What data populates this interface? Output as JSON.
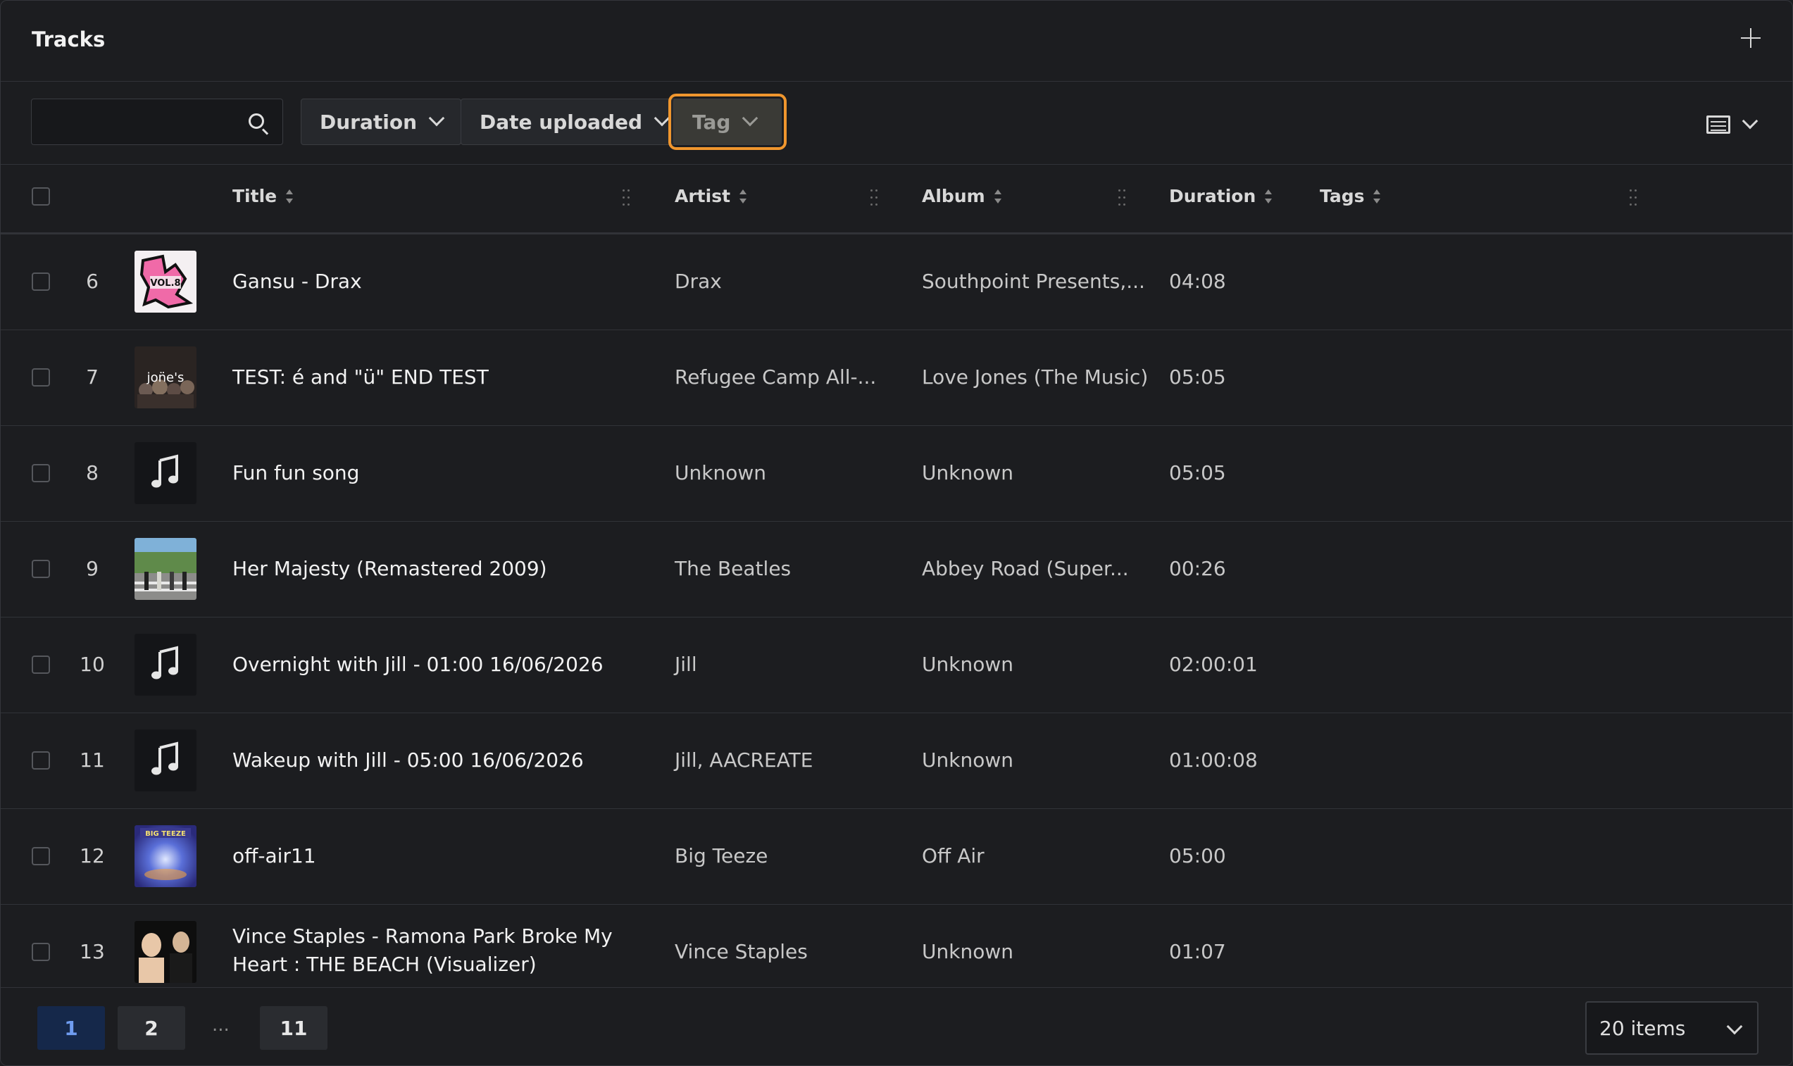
{
  "header": {
    "title": "Tracks",
    "add_icon": "plus-icon"
  },
  "toolbar": {
    "search": {
      "value": "",
      "placeholder": "",
      "icon": "search-icon"
    },
    "filters": {
      "duration": "Duration",
      "date_uploaded": "Date uploaded",
      "tag": "Tag"
    },
    "view_icon": "table-view-icon"
  },
  "table": {
    "columns": {
      "title": "Title",
      "artist": "Artist",
      "album": "Album",
      "duration": "Duration",
      "tags": "Tags"
    },
    "rows": [
      {
        "num": "6",
        "title": "Gansu - Drax",
        "artist": "Drax",
        "album": "Southpoint Presents,...",
        "duration": "04:08",
        "art": "vol8",
        "art_text": "VOL.8"
      },
      {
        "num": "7",
        "title": "TEST: é and \"ü\" END TEST",
        "artist": "Refugee Camp All-...",
        "album": "Love Jones (The Music)",
        "duration": "05:05",
        "art": "jones",
        "art_text": "jon̈e's"
      },
      {
        "num": "8",
        "title": "Fun fun song",
        "artist": "Unknown",
        "album": "Unknown",
        "duration": "05:05",
        "art": "note"
      },
      {
        "num": "9",
        "title": "Her Majesty (Remastered 2009)",
        "artist": "The Beatles",
        "album": "Abbey Road (Super...",
        "duration": "00:26",
        "art": "abbey"
      },
      {
        "num": "10",
        "title": "Overnight with Jill - 01:00 16/06/2026",
        "artist": "Jill",
        "album": "Unknown",
        "duration": "02:00:01",
        "art": "note"
      },
      {
        "num": "11",
        "title": "Wakeup with Jill - 05:00 16/06/2026",
        "artist": "Jill, AACREATE",
        "album": "Unknown",
        "duration": "01:00:08",
        "art": "note"
      },
      {
        "num": "12",
        "title": "off-air11",
        "artist": "Big Teeze",
        "album": "Off Air",
        "duration": "05:00",
        "art": "offair",
        "art_text": "BIG TEEZE"
      },
      {
        "num": "13",
        "title": "Vince Staples - Ramona Park Broke My",
        "title2": "Heart : THE BEACH (Visualizer)",
        "artist": "Vince Staples",
        "album": "Unknown",
        "duration": "01:07",
        "art": "vince"
      }
    ]
  },
  "pagination": {
    "pages": [
      "1",
      "2",
      "11"
    ],
    "ellipsis": "...",
    "active": "1",
    "page_size": "20 items"
  },
  "colors": {
    "background": "#1c1d20",
    "focus_outline": "#f0962e",
    "active_page": "#15284a"
  }
}
